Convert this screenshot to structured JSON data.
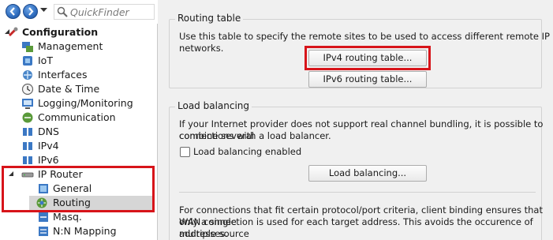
{
  "toolbar": {
    "back_icon": "back-arrow-icon",
    "forward_icon": "forward-arrow-icon",
    "dropdown_icon": "chevron-down-icon",
    "quickfinder_placeholder": "QuickFinder"
  },
  "tree": {
    "root": {
      "label": "Configuration",
      "icon": "configuration-icon"
    },
    "items": [
      {
        "label": "Management",
        "icon": "management-icon"
      },
      {
        "label": "IoT",
        "icon": "iot-icon"
      },
      {
        "label": "Interfaces",
        "icon": "interfaces-icon"
      },
      {
        "label": "Date & Time",
        "icon": "clock-icon"
      },
      {
        "label": "Logging/Monitoring",
        "icon": "monitoring-icon"
      },
      {
        "label": "Communication",
        "icon": "communication-icon"
      },
      {
        "label": "DNS",
        "icon": "dns-icon"
      },
      {
        "label": "IPv4",
        "icon": "ipv4-icon"
      },
      {
        "label": "IPv6",
        "icon": "ipv6-icon"
      },
      {
        "label": "IP Router",
        "icon": "router-icon"
      },
      {
        "label": "General",
        "icon": "general-icon"
      },
      {
        "label": "Routing",
        "icon": "routing-icon",
        "selected": true
      },
      {
        "label": "Masq.",
        "icon": "masquerading-icon"
      },
      {
        "label": "N:N Mapping",
        "icon": "mapping-icon"
      }
    ]
  },
  "routing_table": {
    "title": "Routing table",
    "description": "Use this table to specify the remote sites to be used to access different remote IP networks.",
    "ipv4_button": "IPv4 routing table...",
    "ipv6_button": "IPv6 routing table..."
  },
  "load_balancing": {
    "title": "Load balancing",
    "description_line1": "If your Internet provider does not support real channel bundling, it is possible to combine several",
    "description_line2": "connections with a load balancer.",
    "checkbox_label": "Load balancing enabled",
    "checkbox_checked": false,
    "button": "Load balancing...",
    "policy_line1": "For connections that fit certain protocol/port criteria, client binding ensures that only a single",
    "policy_line2": "WAN connection is used for each target address. This avoids the occurence of multiple source",
    "policy_line3": "addresses."
  },
  "colors": {
    "highlight": "#d7141a",
    "selection": "#d6d6d6",
    "panel": "#f0f0f0"
  }
}
